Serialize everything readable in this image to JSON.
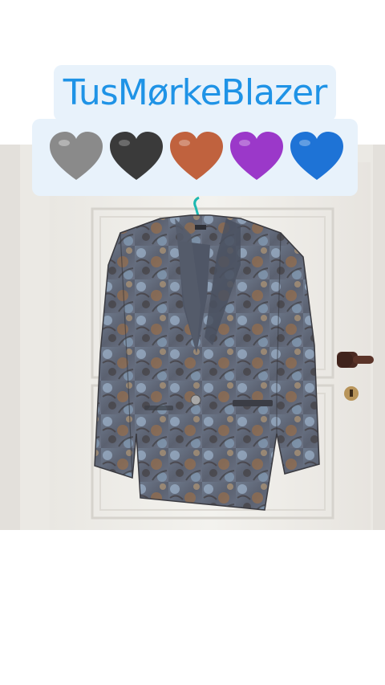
{
  "title": "TusMørkeBlazer",
  "hearts": [
    {
      "icon": "grey-heart-icon",
      "color": "#8a8a8a"
    },
    {
      "icon": "black-heart-icon",
      "color": "#3a3a3a"
    },
    {
      "icon": "orange-heart-icon",
      "color": "#c0623e"
    },
    {
      "icon": "purple-heart-icon",
      "color": "#9b38c9"
    },
    {
      "icon": "blue-heart-icon",
      "color": "#1e73d6"
    }
  ],
  "colors": {
    "caption_background": "#e8f2fb",
    "title_text": "#1f93e6",
    "door": "#f1efea",
    "wall": "#e3e0db"
  }
}
